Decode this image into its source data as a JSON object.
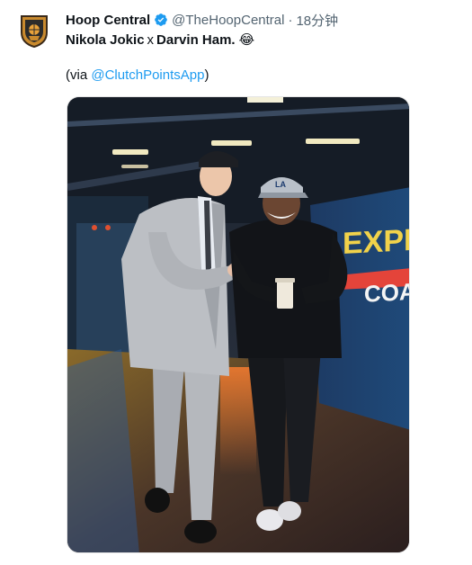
{
  "author": {
    "name": "Hoop Central",
    "handle": "@TheHoopCentral",
    "separator": "·",
    "time": "18分钟",
    "avatar_icon": "hoop-central-shield-logo",
    "verified_icon": "verified-badge-icon"
  },
  "body": {
    "name1": "Nikola Jokic",
    "x": "x",
    "name2": "Darvin Ham.",
    "emoji": "😂",
    "via_prefix": "(via ",
    "via_link": "@ClutchPointsApp",
    "via_suffix": ")"
  },
  "media": {
    "bus_text_1": "EXPR",
    "bus_text_2": "COAC",
    "cap_logo": "LA"
  },
  "colors": {
    "link": "#1d9bf0",
    "verified": "#1d9bf0",
    "muted": "#536471"
  }
}
